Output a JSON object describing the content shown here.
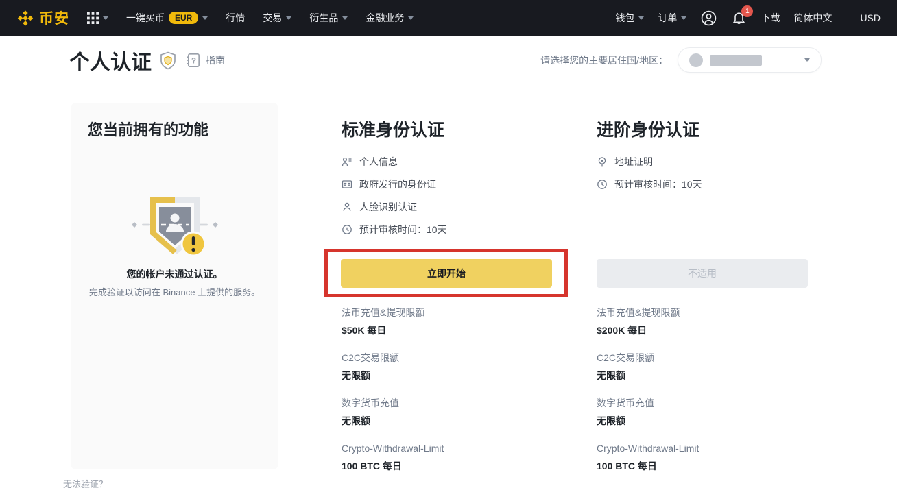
{
  "nav": {
    "brand": "币安",
    "menu": [
      {
        "label": "一键买币",
        "badge": "EUR"
      },
      {
        "label": "行情"
      },
      {
        "label": "交易"
      },
      {
        "label": "衍生品"
      },
      {
        "label": "金融业务"
      }
    ],
    "wallet": "钱包",
    "orders": "订单",
    "notification_count": "1",
    "download": "下载",
    "language": "简体中文",
    "currency": "USD"
  },
  "header": {
    "title": "个人认证",
    "guide": "指南",
    "residence_label": "请选择您的主要居住国/地区："
  },
  "current": {
    "title": "您当前拥有的功能",
    "status_title": "您的帐户未通过认证。",
    "status_desc": "完成验证以访问在 Binance 上提供的服务。"
  },
  "standard": {
    "title": "标准身份认证",
    "features": [
      {
        "icon": "profile-info-icon",
        "label": "个人信息"
      },
      {
        "icon": "id-card-icon",
        "label": "政府发行的身份证"
      },
      {
        "icon": "face-id-icon",
        "label": "人脸识别认证"
      },
      {
        "icon": "clock-icon",
        "label": "预计审核时间：10天"
      }
    ],
    "cta": "立即开始",
    "limits": [
      {
        "label": "法币充值&提现限额",
        "value": "$50K 每日"
      },
      {
        "label": "C2C交易限额",
        "value": "无限额"
      },
      {
        "label": "数字货币充值",
        "value": "无限额"
      },
      {
        "label": "Crypto-Withdrawal-Limit",
        "value": "100 BTC 每日"
      }
    ]
  },
  "advanced": {
    "title": "进阶身份认证",
    "features": [
      {
        "icon": "location-icon",
        "label": "地址证明"
      },
      {
        "icon": "clock-icon",
        "label": "预计审核时间：10天"
      }
    ],
    "cta": "不适用",
    "limits": [
      {
        "label": "法币充值&提现限额",
        "value": "$200K 每日"
      },
      {
        "label": "C2C交易限额",
        "value": "无限额"
      },
      {
        "label": "数字货币充值",
        "value": "无限额"
      },
      {
        "label": "Crypto-Withdrawal-Limit",
        "value": "100 BTC 每日"
      }
    ]
  },
  "footer": {
    "cut_text": "无法验证？"
  },
  "colors": {
    "brand_gold": "#F0B90B",
    "button_yellow": "#F0D160",
    "annotation_red": "#D6352D",
    "nav_bg": "#181A20",
    "card_bg": "#FAFAFA",
    "badge_red": "#E2564D"
  }
}
